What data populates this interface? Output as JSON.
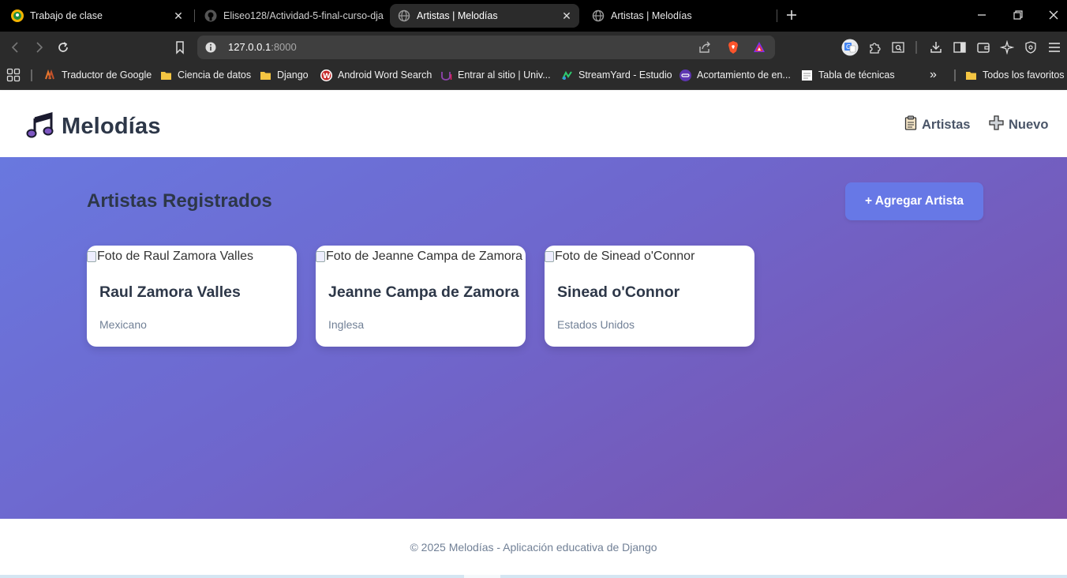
{
  "browser": {
    "tabs": [
      {
        "label": "Trabajo de clase",
        "active": false
      },
      {
        "label": "Eliseo128/Actividad-5-final-curso-dja",
        "active": false
      },
      {
        "label": "Artistas | Melodías",
        "active": true
      },
      {
        "label": "Artistas | Melodías",
        "active": false
      }
    ],
    "url_host": "127.0.0.1",
    "url_port": ":8000",
    "bookmarks": [
      {
        "label": "Traductor de Google",
        "icon": "google-translate-icon"
      },
      {
        "label": "Ciencia de datos",
        "icon": "folder-icon"
      },
      {
        "label": "Django",
        "icon": "folder-icon"
      },
      {
        "label": "Android Word Search",
        "icon": "w-logo-icon"
      },
      {
        "label": "Entrar al sitio | Univ...",
        "icon": "university-icon"
      },
      {
        "label": "StreamYard - Estudio",
        "icon": "streamyard-icon"
      },
      {
        "label": "Acortamiento de en...",
        "icon": "link-shortener-icon"
      },
      {
        "label": "Tabla de técnicas",
        "icon": "document-icon"
      }
    ],
    "bookmarks_more": "»",
    "all_bookmarks": "Todos los favoritos"
  },
  "site": {
    "brand": "Melodías",
    "nav": {
      "artists": "Artistas",
      "new": "Nuevo"
    }
  },
  "main": {
    "title": "Artistas Registrados",
    "add_button": "+ Agregar Artista",
    "artists": [
      {
        "photo_alt": "Foto de Raul Zamora Valles",
        "name": "Raul Zamora Valles",
        "country": "Mexicano"
      },
      {
        "photo_alt": "Foto de Jeanne Campa de Zamora",
        "name": "Jeanne Campa de Zamora",
        "country": "Inglesa"
      },
      {
        "photo_alt": "Foto de Sinead o'Connor",
        "name": "Sinead o'Connor",
        "country": "Estados Unidos"
      }
    ]
  },
  "footer": {
    "text": "© 2025 Melodías - Aplicación educativa de Django"
  },
  "colors": {
    "gradient_start": "#6978df",
    "gradient_end": "#7a4fa8",
    "button": "#6778e6",
    "heading": "#2d3748",
    "muted": "#718096"
  }
}
